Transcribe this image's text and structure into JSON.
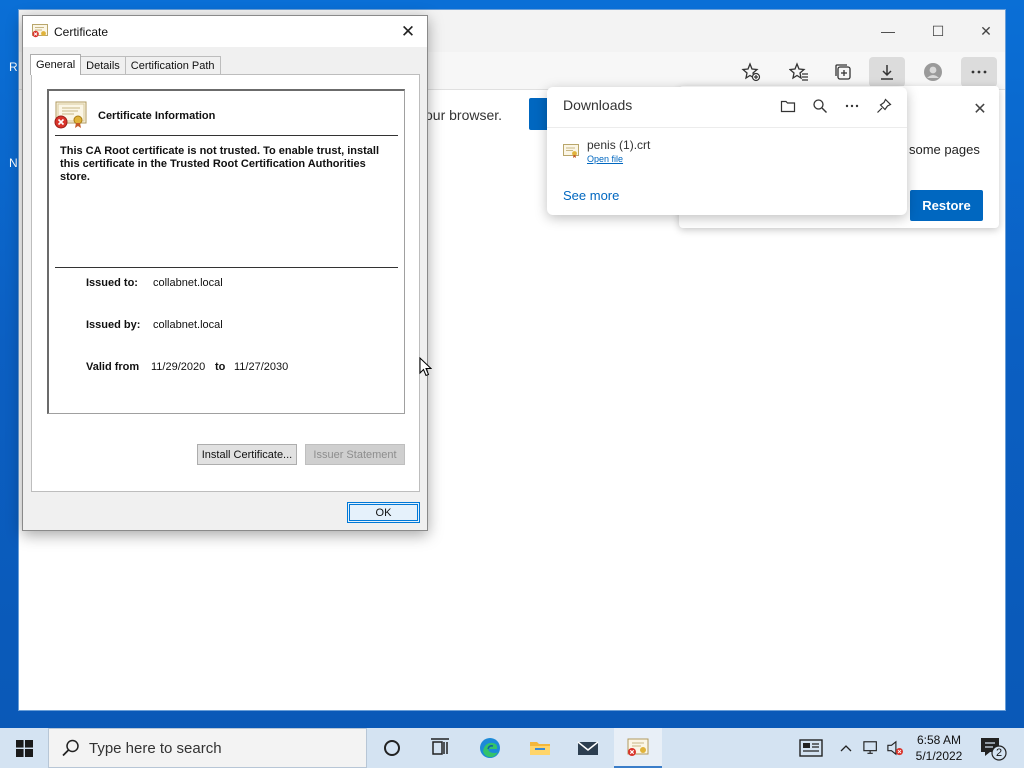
{
  "desktop": {
    "glyphs": [
      "R",
      "N"
    ]
  },
  "browser": {
    "window_controls": {
      "minimize": "—",
      "maximize": "☐",
      "close": "✕"
    },
    "page_text": "our browser.",
    "toolbar_icons": [
      "favorite-add-icon",
      "favorites-icon",
      "collections-icon",
      "downloads-icon",
      "profile-icon",
      "more-icon"
    ]
  },
  "restore_banner": {
    "text": "some pages",
    "close": "✕",
    "restore_label": "Restore"
  },
  "downloads": {
    "title": "Downloads",
    "file_name": "penis (1).crt",
    "open_file_label": "Open file",
    "see_more_label": "See more",
    "actions": [
      "open-folder-icon",
      "search-icon",
      "more-options-icon",
      "pin-icon"
    ]
  },
  "certificate": {
    "title": "Certificate",
    "close": "✕",
    "tabs": [
      {
        "label": "General"
      },
      {
        "label": "Details"
      },
      {
        "label": "Certification Path"
      }
    ],
    "info_title": "Certificate Information",
    "warning": "This CA Root certificate is not trusted. To enable trust, install this certificate in the Trusted Root Certification Authorities store.",
    "issued_to_label": "Issued to:",
    "issued_to": "collabnet.local",
    "issued_by_label": "Issued by:",
    "issued_by": "collabnet.local",
    "valid_from_label": "Valid from",
    "valid_from": "11/29/2020",
    "to_label": "to",
    "valid_to": "11/27/2030",
    "install_label": "Install Certificate...",
    "issuer_statement_label": "Issuer Statement",
    "ok_label": "OK"
  },
  "taskbar": {
    "search_placeholder": "Type here to search",
    "time": "6:58 AM",
    "date": "5/1/2022",
    "notification_count": "2",
    "colors": {
      "accent": "#0067c0",
      "taskbar": "#d4e3f2"
    }
  }
}
